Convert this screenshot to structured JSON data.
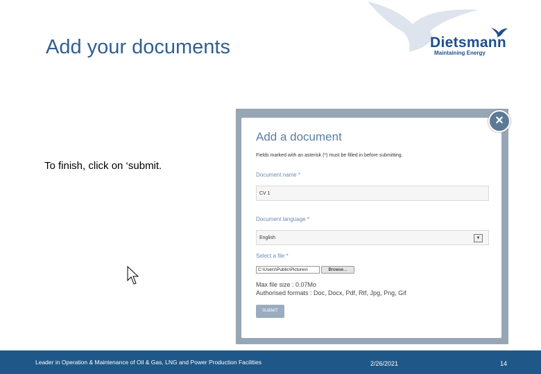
{
  "slide": {
    "title": "Add your documents",
    "instruction": "To finish, click on ‘submit."
  },
  "logo": {
    "name": "Dietsmann",
    "tagline": "Maintaining Energy"
  },
  "dialog": {
    "title": "Add a document",
    "note": "Fields marked with an asterisk (*) must be filled in before submitting.",
    "document_name_label": "Document name *",
    "document_name_value": "CV 1",
    "document_language_label": "Document language *",
    "document_language_value": "English",
    "select_file_label": "Select a file *",
    "file_path": "C:\\Users\\Public\\Pictures\\",
    "browse_label": "Browse...",
    "max_size": "Max file size : 0.07Mo",
    "formats": "Authorised formats : Doc, Docx, Pdf, Rtf, Jpg, Png, Gif",
    "submit_label": "SUBMIT",
    "close_icon": "close-icon"
  },
  "footer": {
    "text": "Leader in Operation & Maintenance of Oil & Gas, LNG and Power Production Facilities",
    "date": "2/26/2021",
    "page": "14"
  },
  "colors": {
    "title": "#2f5f8f",
    "footer_bg": "#1f5888",
    "dialog_frame": "#97a6b4",
    "dialog_accent": "#5a7ea6"
  }
}
